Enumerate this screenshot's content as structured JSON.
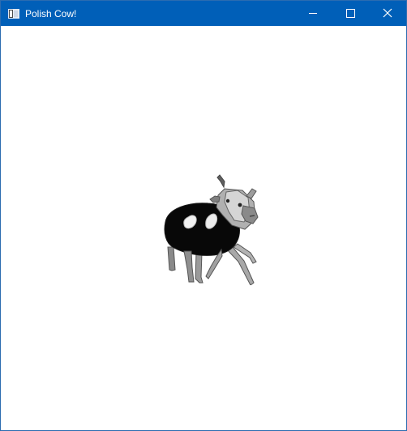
{
  "window": {
    "title": "Polish Cow!",
    "icon": "app-window-icon",
    "buttons": {
      "minimize_icon": "minimize-icon",
      "maximize_icon": "maximize-icon",
      "close_icon": "close-icon"
    },
    "titlebar_color": "#005fb8"
  },
  "content": {
    "image_subject": "cow-image",
    "background_color": "#ffffff"
  }
}
